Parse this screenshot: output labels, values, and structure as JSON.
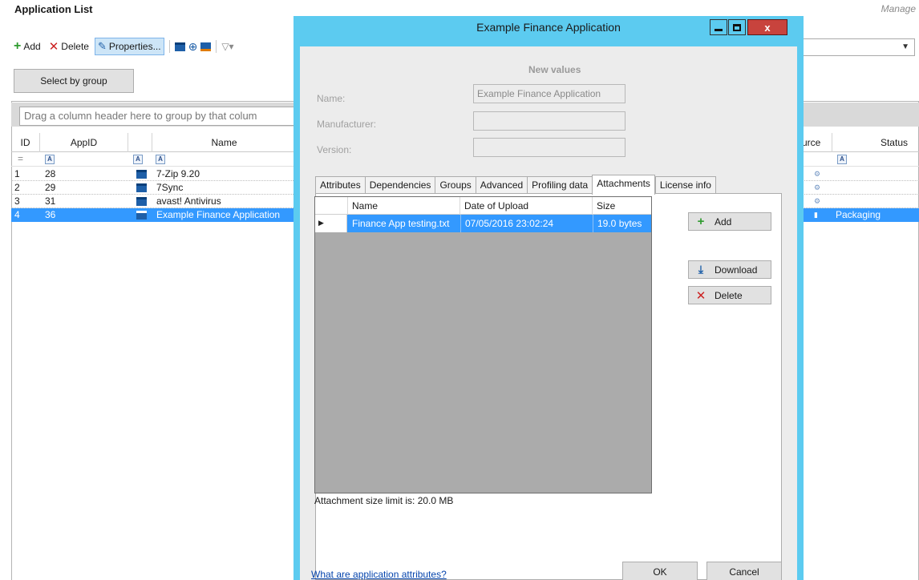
{
  "app": {
    "title": "Application List",
    "right_label": "Manage",
    "toolbar": {
      "add_label": "Add",
      "delete_label": "Delete",
      "properties_label": "Properties..."
    },
    "select_by_group_label": "Select by group",
    "drag_hint": "Drag a column header here to group by that colum",
    "columns": {
      "id": "ID",
      "appid": "AppID",
      "name": "Name",
      "source": "urce",
      "status": "Status"
    },
    "rows": [
      {
        "id": "1",
        "appid": "28",
        "name": "7-Zip 9.20",
        "status": ""
      },
      {
        "id": "2",
        "appid": "29",
        "name": "7Sync",
        "status": ""
      },
      {
        "id": "3",
        "appid": "31",
        "name": "avast! Antivirus",
        "status": ""
      },
      {
        "id": "4",
        "appid": "36",
        "name": "Example Finance Application",
        "status": "Packaging"
      }
    ],
    "selected_row_index": 3
  },
  "dialog": {
    "title": "Example Finance Application",
    "new_values_heading": "New values",
    "fields": {
      "name_label": "Name:",
      "name_value": "Example Finance Application",
      "manufacturer_label": "Manufacturer:",
      "manufacturer_value": "",
      "version_label": "Version:",
      "version_value": ""
    },
    "tabs": [
      "Attributes",
      "Dependencies",
      "Groups",
      "Advanced",
      "Profiling data",
      "Attachments",
      "License info"
    ],
    "active_tab": "Attachments",
    "attachments": {
      "columns": {
        "name": "Name",
        "date": "Date of Upload",
        "size": "Size"
      },
      "rows": [
        {
          "name": "Finance App testing.txt",
          "date": "07/05/2016 23:02:24",
          "size": "19.0 bytes"
        }
      ],
      "add_label": "Add",
      "download_label": "Download",
      "delete_label": "Delete",
      "limit_text": "Attachment size limit is: 20.0 MB"
    },
    "help_link": "What are application attributes?",
    "ok_label": "OK",
    "cancel_label": "Cancel",
    "window_close_glyph": "x"
  },
  "colors": {
    "dialog_frame": "#5ccbf0",
    "selection": "#3399ff",
    "close_button": "#c8433d"
  }
}
